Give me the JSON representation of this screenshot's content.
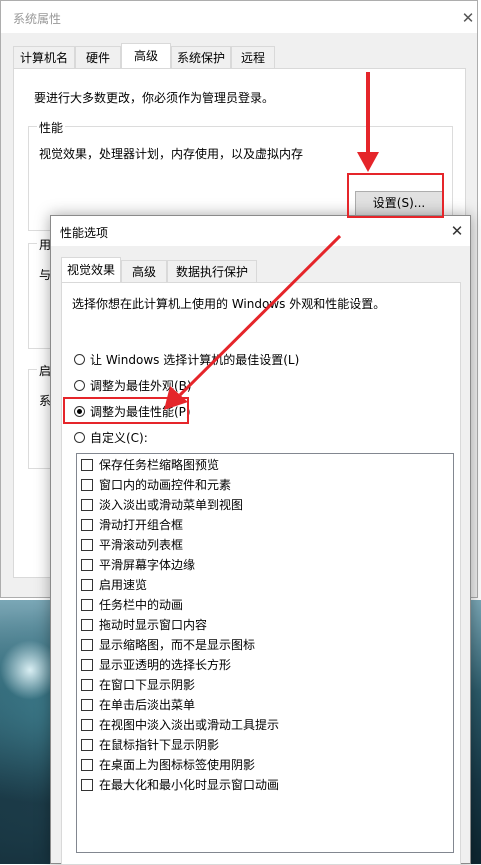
{
  "system_properties": {
    "title": "系统属性",
    "close_glyph": "✕",
    "tabs": [
      {
        "label": "计算机名"
      },
      {
        "label": "硬件"
      },
      {
        "label": "高级"
      },
      {
        "label": "系统保护"
      },
      {
        "label": "远程"
      }
    ],
    "active_tab": "高级",
    "admin_notice": "要进行大多数更改，你必须作为管理员登录。",
    "performance": {
      "label": "性能",
      "description": "视觉效果，处理器计划，内存使用，以及虚拟内存",
      "settings_button": "设置(S)..."
    },
    "partial_group_labels": [
      "用",
      "与",
      "启",
      "系"
    ]
  },
  "performance_options": {
    "title": "性能选项",
    "close_glyph": "✕",
    "tabs": [
      {
        "label": "视觉效果"
      },
      {
        "label": "高级"
      },
      {
        "label": "数据执行保护"
      }
    ],
    "active_tab": "视觉效果",
    "instruction": "选择你想在此计算机上使用的 Windows 外观和性能设置。",
    "radio_options": [
      {
        "label": "让 Windows 选择计算机的最佳设置(L)",
        "checked": false
      },
      {
        "label": "调整为最佳外观(B)",
        "checked": false
      },
      {
        "label": "调整为最佳性能(P)",
        "checked": true
      },
      {
        "label": "自定义(C):",
        "checked": false
      }
    ],
    "effects": [
      {
        "label": "保存任务栏缩略图预览",
        "checked": false
      },
      {
        "label": "窗口内的动画控件和元素",
        "checked": false
      },
      {
        "label": "淡入淡出或滑动菜单到视图",
        "checked": false
      },
      {
        "label": "滑动打开组合框",
        "checked": false
      },
      {
        "label": "平滑滚动列表框",
        "checked": false
      },
      {
        "label": "平滑屏幕字体边缘",
        "checked": false
      },
      {
        "label": "启用速览",
        "checked": false
      },
      {
        "label": "任务栏中的动画",
        "checked": false
      },
      {
        "label": "拖动时显示窗口内容",
        "checked": false
      },
      {
        "label": "显示缩略图，而不是显示图标",
        "checked": false
      },
      {
        "label": "显示亚透明的选择长方形",
        "checked": false
      },
      {
        "label": "在窗口下显示阴影",
        "checked": false
      },
      {
        "label": "在单击后淡出菜单",
        "checked": false
      },
      {
        "label": "在视图中淡入淡出或滑动工具提示",
        "checked": false
      },
      {
        "label": "在鼠标指针下显示阴影",
        "checked": false
      },
      {
        "label": "在桌面上为图标标签使用阴影",
        "checked": false
      },
      {
        "label": "在最大化和最小化时显示窗口动画",
        "checked": false
      }
    ]
  },
  "annotation_color": "#e5252a"
}
